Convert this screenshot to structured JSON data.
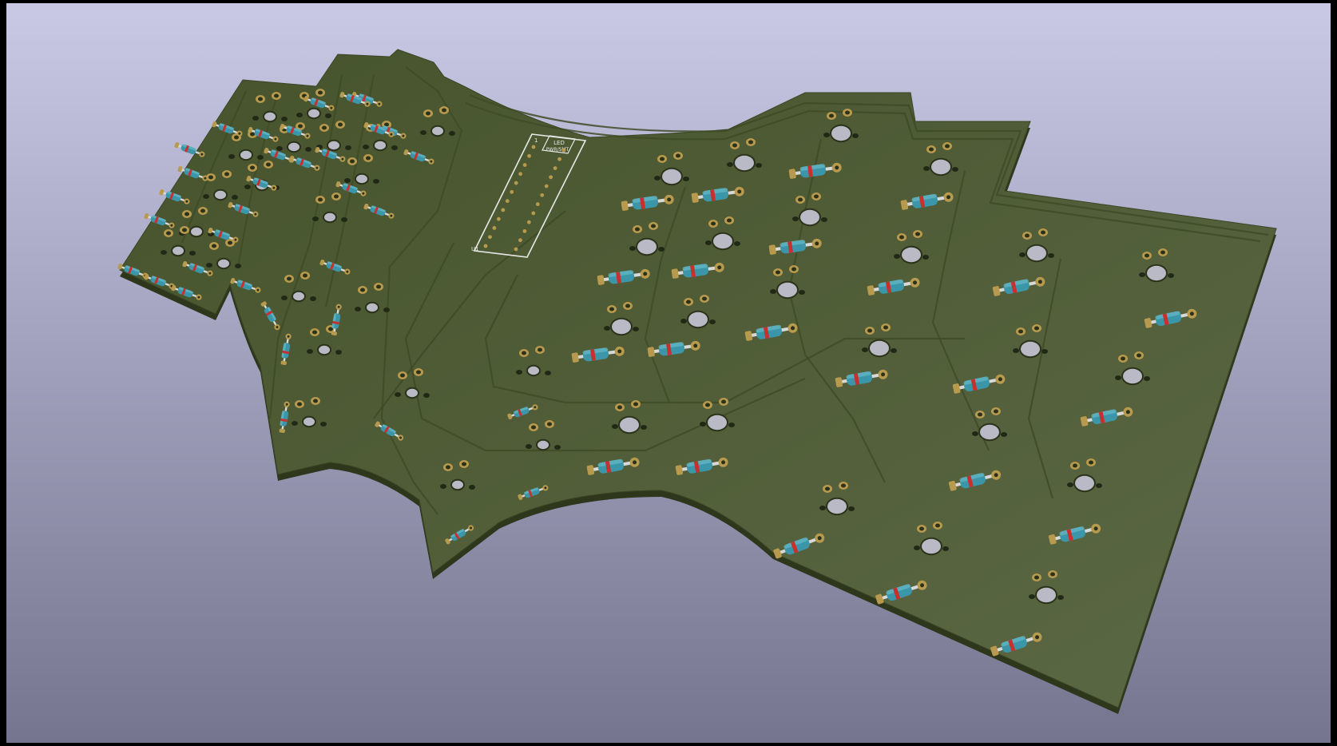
{
  "viewer": {
    "background_top": "#c9c9e6",
    "background_bottom": "#75758f"
  },
  "board": {
    "mask_color": "#46532c",
    "mask_highlight": "#5b6844",
    "copper_color": "#b89a4e",
    "trace_color": "#3e4b26"
  },
  "controller": {
    "label_line1": "LED",
    "label_line2": "PWR/SMT",
    "pin1_label": "1",
    "ref_label": "U1"
  },
  "components": {
    "diode_body": "#3a96a8",
    "diode_band": "#c8302e",
    "diode_count": 80
  }
}
